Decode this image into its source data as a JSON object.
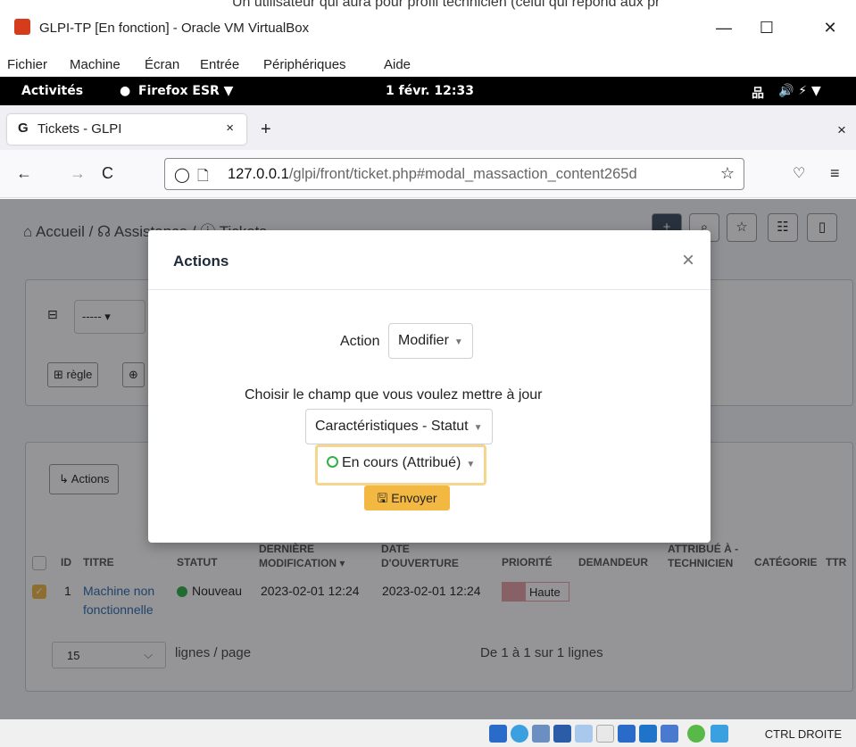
{
  "vbox": {
    "bg_text": "Un utilisateur qui aura pour profil technicien (celui qui répond aux pr",
    "title": "GLPI-TP [En fonction] - Oracle VM VirtualBox",
    "minimize": "—",
    "maximize": "☐",
    "close": "✕",
    "menu": [
      "Fichier",
      "Machine",
      "Écran",
      "Entrée",
      "Périphériques",
      "Aide"
    ],
    "host_key": "CTRL DROITE"
  },
  "gnome": {
    "activities": "Activités",
    "app": "Firefox ESR ▼",
    "clock": "1 févr. 12:33",
    "tray": "🔊 ⚡ ▼"
  },
  "firefox": {
    "tab_title": "Tickets - GLPI",
    "tab_close": "×",
    "new_tab": "+",
    "url_host": "127.0.0.1",
    "url_path": "/glpi/front/ticket.php#modal_massaction_content265d",
    "back": "←",
    "forward": "→",
    "reload": "C",
    "menu": "≡",
    "close_all": "×"
  },
  "breadcrumb": "⌂ Accueil / ☊ Assistance / ⓘ Tickets",
  "search": {
    "criteria_select": "----- ▾",
    "rule_button": "⊞ règle",
    "global_button": "⊕"
  },
  "list": {
    "actions_button": "↳ Actions",
    "columns": [
      "ID",
      "TITRE",
      "STATUT",
      "DERNIÈRE MODIFICATION ▾",
      "DATE D'OUVERTURE",
      "PRIORITÉ",
      "DEMANDEUR",
      "ATTRIBUÉ À - TECHNICIEN",
      "CATÉGORIE",
      "TTR"
    ],
    "rows": [
      {
        "id": "1",
        "title_line1": "Machine non",
        "title_line2": "fonctionnelle",
        "status": "Nouveau",
        "modified": "2023-02-01 12:24",
        "opened": "2023-02-01 12:24",
        "priority": "Haute"
      }
    ],
    "per_page_value": "15",
    "per_page_label": "lignes / page",
    "pagination": "De 1 à 1 sur 1 lignes"
  },
  "modal": {
    "title": "Actions",
    "close": "×",
    "action_label": "Action",
    "action_value": "Modifier",
    "field_label": "Choisir le champ que vous voulez mettre à jour",
    "field_value": "Caractéristiques - Statut",
    "status_value": "En cours (Attribué)",
    "submit_label": "Envoyer"
  },
  "colors": {
    "accent": "#f2b842",
    "status_new": "#2fb344",
    "priority_high": "#e8a0a8"
  }
}
